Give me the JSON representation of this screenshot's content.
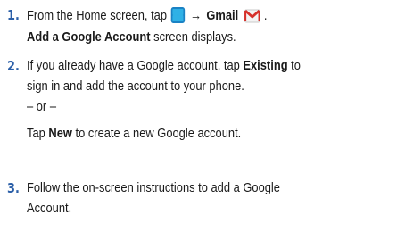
{
  "steps": [
    {
      "number": "1.",
      "line1": {
        "prefix": "From the Home screen, tap",
        "arrow": "→",
        "target": "Gmail"
      },
      "line2": {
        "bold": "Add a Google Account",
        "rest": " screen displays."
      }
    },
    {
      "number": "2.",
      "line1": {
        "prefix": "If you already have a Google account, tap ",
        "bold": "Existing",
        "rest": " to"
      },
      "line2": "sign in and add the account to your phone.",
      "line3": "– or –",
      "line4": {
        "prefix": "Tap ",
        "bold": "New",
        "rest": " to create a new Google account."
      }
    },
    {
      "number": "3.",
      "line1": "Follow the on-screen instructions to add a Google",
      "line2": "Account."
    }
  ],
  "icons": {
    "apps": "applications-grid-icon",
    "gmail": "gmail-envelope-icon"
  },
  "colors": {
    "step_number": "#2b5fa8",
    "apps_icon": "#1a82c4",
    "gmail_red": "#d6302a"
  }
}
